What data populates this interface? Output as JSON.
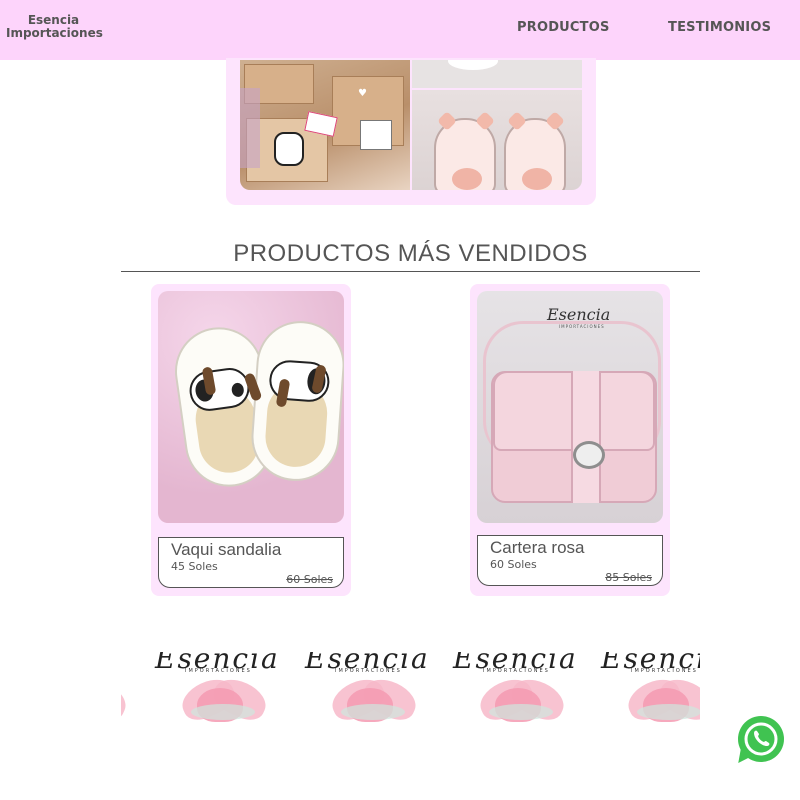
{
  "header": {
    "brand_line1": "Esencia",
    "brand_line2": "Importaciones",
    "nav": [
      {
        "label": "PRODUCTOS"
      },
      {
        "label": "TESTIMONIOS"
      }
    ],
    "background": "#fdd4fb"
  },
  "hero": {
    "images": [
      "boxes-gift-icon",
      "pig-slippers-icon"
    ]
  },
  "best_sellers": {
    "title": "PRODUCTOS MÁS VENDIDOS",
    "products": [
      {
        "name": "Vaqui sandalia",
        "price": "45 Soles",
        "old_price": "60 Soles",
        "image": "cow-sandal-icon"
      },
      {
        "name": "Cartera rosa",
        "price": "60 Soles",
        "old_price": "85 Soles",
        "image": "pink-bag-icon"
      }
    ],
    "card_background": "#fde4fd"
  },
  "banner": {
    "logo_text": "Esencia",
    "logo_subtitle": "IMPORTACIONES"
  },
  "whatsapp": {
    "icon": "whatsapp-icon",
    "color": "#40c351"
  }
}
